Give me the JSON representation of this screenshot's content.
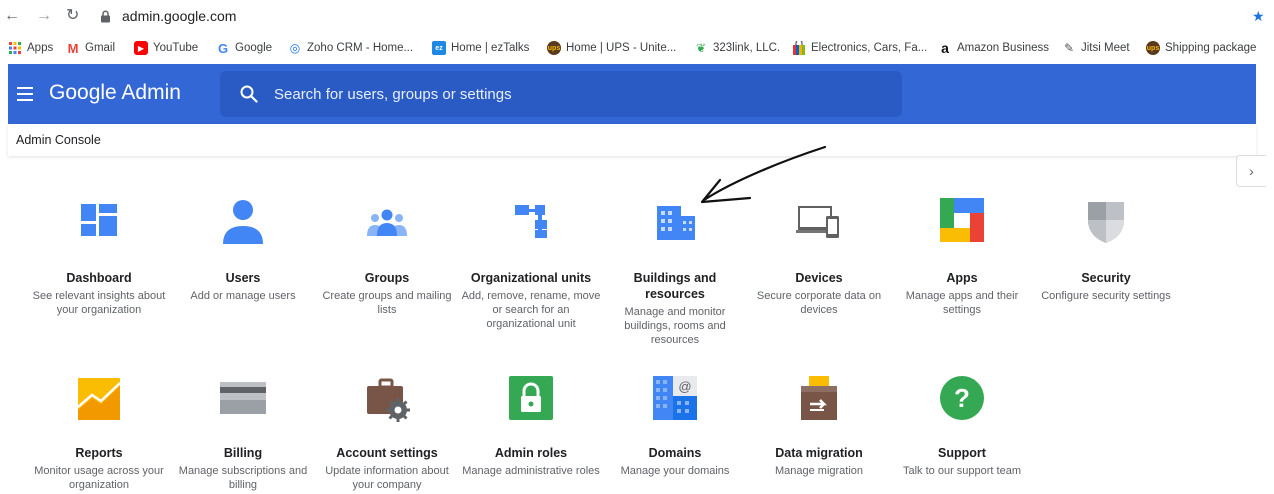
{
  "browser": {
    "url": "admin.google.com",
    "bookmarks": [
      {
        "label": "Apps",
        "icon": "apps-grid-icon"
      },
      {
        "label": "Gmail",
        "icon": "gmail-icon"
      },
      {
        "label": "YouTube",
        "icon": "youtube-icon"
      },
      {
        "label": "Google",
        "icon": "google-icon"
      },
      {
        "label": "Zoho CRM - Home...",
        "icon": "zoho-icon"
      },
      {
        "label": "Home | ezTalks",
        "icon": "eztalks-icon"
      },
      {
        "label": "Home | UPS - Unite...",
        "icon": "ups-icon"
      },
      {
        "label": "323link, LLC.",
        "icon": "leaf-icon"
      },
      {
        "label": "Electronics, Cars, Fa...",
        "icon": "ebay-bag-icon"
      },
      {
        "label": "Amazon Business",
        "icon": "amazon-icon"
      },
      {
        "label": "Jitsi Meet",
        "icon": "jitsi-icon"
      },
      {
        "label": "Shipping package",
        "icon": "ups-icon"
      }
    ]
  },
  "header": {
    "brand": "Google Admin",
    "search_placeholder": "Search for users, groups or settings",
    "color": "#3367d6"
  },
  "console": {
    "title": "Admin Console"
  },
  "tiles": [
    {
      "title": "Dashboard",
      "desc": "See relevant insights about your organization",
      "icon": "dashboard-icon"
    },
    {
      "title": "Users",
      "desc": "Add or manage users",
      "icon": "user-icon"
    },
    {
      "title": "Groups",
      "desc": "Create groups and mailing lists",
      "icon": "groups-icon"
    },
    {
      "title": "Organizational units",
      "desc": "Add, remove, rename, move or search for an organizational unit",
      "icon": "org-units-icon"
    },
    {
      "title": "Buildings and resources",
      "desc": "Manage and monitor buildings, rooms and resources",
      "icon": "building-icon"
    },
    {
      "title": "Devices",
      "desc": "Secure corporate data on devices",
      "icon": "devices-icon"
    },
    {
      "title": "Apps",
      "desc": "Manage apps and their settings",
      "icon": "apps-icon"
    },
    {
      "title": "Security",
      "desc": "Configure security settings",
      "icon": "shield-icon"
    },
    {
      "title": "Reports",
      "desc": "Monitor usage across your organization",
      "icon": "reports-chart-icon"
    },
    {
      "title": "Billing",
      "desc": "Manage subscriptions and billing",
      "icon": "credit-card-icon"
    },
    {
      "title": "Account settings",
      "desc": "Update information about your company",
      "icon": "briefcase-gear-icon"
    },
    {
      "title": "Admin roles",
      "desc": "Manage administrative roles",
      "icon": "lock-icon"
    },
    {
      "title": "Domains",
      "desc": "Manage your domains",
      "icon": "domains-icon"
    },
    {
      "title": "Data migration",
      "desc": "Manage migration",
      "icon": "migration-box-icon"
    },
    {
      "title": "Support",
      "desc": "Talk to our support team",
      "icon": "help-icon"
    }
  ]
}
